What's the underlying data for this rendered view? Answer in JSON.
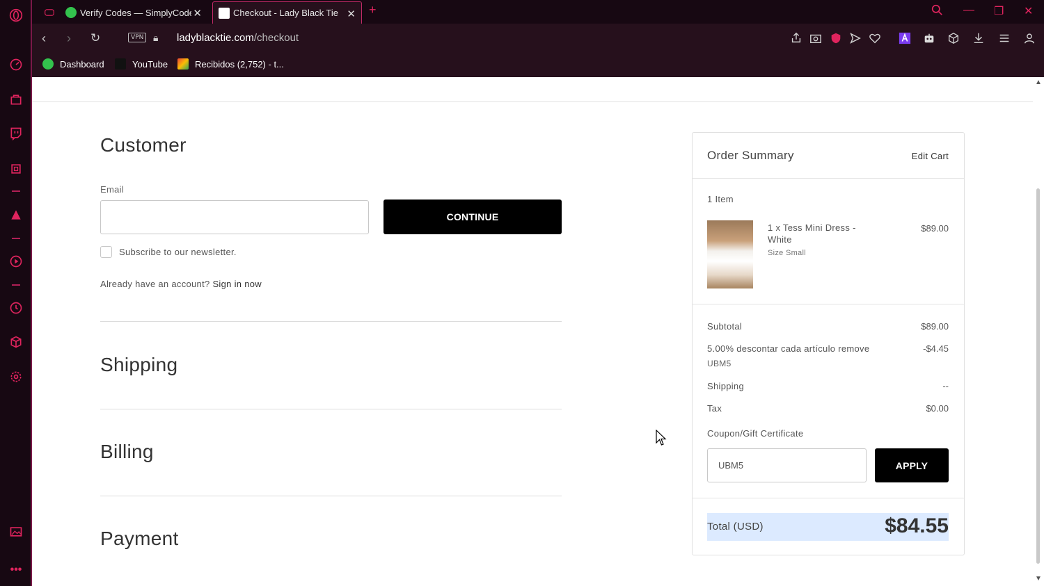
{
  "browser": {
    "tabs": [
      {
        "title": "Verify Codes — SimplyCodes",
        "active": false
      },
      {
        "title": "Checkout - Lady Black Tie",
        "active": true
      }
    ],
    "vpn_label": "VPN",
    "url_domain": "ladyblacktie.com",
    "url_path": "/checkout",
    "bookmarks": [
      "Dashboard",
      "YouTube",
      "Recibidos (2,752) - t..."
    ]
  },
  "checkout": {
    "customer": {
      "heading": "Customer",
      "email_label": "Email",
      "email_value": "",
      "continue_label": "CONTINUE",
      "newsletter_label": "Subscribe to our newsletter.",
      "account_prompt": "Already have an account?",
      "sign_in_label": "Sign in now"
    },
    "shipping_heading": "Shipping",
    "billing_heading": "Billing",
    "payment_heading": "Payment"
  },
  "summary": {
    "title": "Order Summary",
    "edit_cart": "Edit Cart",
    "item_count": "1 Item",
    "item": {
      "name": "1 x Tess Mini Dress - White",
      "size": "Size Small",
      "price": "$89.00"
    },
    "subtotal_label": "Subtotal",
    "subtotal": "$89.00",
    "discount_label": "5.00% descontar cada artículo remove",
    "discount_code": "UBM5",
    "discount": "-$4.45",
    "shipping_label": "Shipping",
    "shipping": "--",
    "tax_label": "Tax",
    "tax": "$0.00",
    "coupon_label": "Coupon/Gift Certificate",
    "coupon_value": "UBM5",
    "apply_label": "APPLY",
    "total_label": "Total (USD)",
    "total": "$84.55"
  },
  "colors": {
    "accent": "#e0245e",
    "browser_bg": "#170812",
    "button_black": "#000000",
    "total_highlight": "#dceaff"
  },
  "icons": [
    "opera-logo-icon",
    "speed-dial-icon",
    "bag-icon",
    "twitch-icon",
    "cpu-icon",
    "aria-icon",
    "player-icon",
    "history-icon",
    "box-icon",
    "settings-icon",
    "gallery-icon",
    "more-icon"
  ]
}
